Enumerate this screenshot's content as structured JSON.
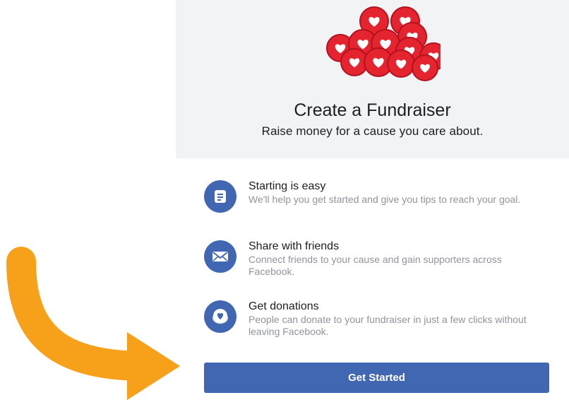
{
  "hero": {
    "title": "Create a Fundraiser",
    "subtitle": "Raise money for a cause you care about.",
    "art_icon": "hearts-pile-illustration",
    "art_color": "#e4242f"
  },
  "features": [
    {
      "icon": "document-icon",
      "title": "Starting is easy",
      "description": "We'll help you get started and give you tips to reach your goal."
    },
    {
      "icon": "envelope-icon",
      "title": "Share with friends",
      "description": "Connect friends to your cause and gain supporters across Facebook."
    },
    {
      "icon": "heart-coin-icon",
      "title": "Get donations",
      "description": "People can donate to your fundraiser in just a few clicks without leaving Facebook."
    }
  ],
  "cta": {
    "label": "Get Started"
  },
  "annotation": {
    "icon": "curved-arrow-icon",
    "color": "#f7a11a"
  },
  "colors": {
    "accent": "#4267b2",
    "hero_bg": "#f2f3f5",
    "text_muted": "#90949c"
  }
}
